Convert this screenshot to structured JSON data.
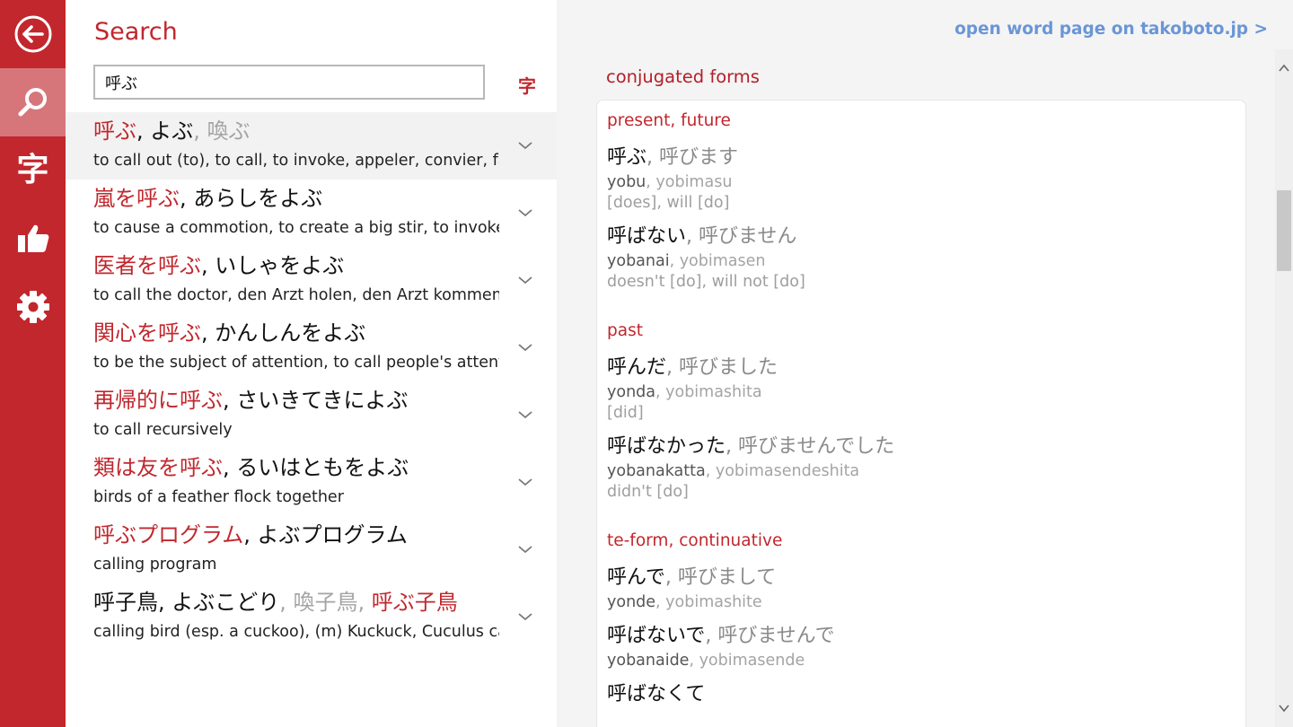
{
  "search": {
    "title": "Search",
    "query": "呼ぶ",
    "kanji_toggle": "字"
  },
  "rail": {
    "kanji_label": "字",
    "icons": [
      "back-icon",
      "search-icon",
      "kanji-icon",
      "thumbs-up-icon",
      "gear-icon"
    ]
  },
  "results": [
    {
      "head": [
        {
          "t": "呼ぶ",
          "c": "m"
        },
        {
          "t": ", ",
          "c": "s"
        },
        {
          "t": "よぶ",
          "c": "k"
        },
        {
          "t": ", 喚ぶ",
          "c": "g"
        }
      ],
      "gloss": "to call out (to), to call, to invoke, appeler, convier, faire venir"
    },
    {
      "head": [
        {
          "t": "嵐を呼ぶ",
          "c": "m"
        },
        {
          "t": ", ",
          "c": "s"
        },
        {
          "t": "あらしをよぶ",
          "c": "k"
        }
      ],
      "gloss": "to cause a commotion, to create a big stir, to invoke a storm"
    },
    {
      "head": [
        {
          "t": "医者を呼ぶ",
          "c": "m"
        },
        {
          "t": ", ",
          "c": "s"
        },
        {
          "t": "いしゃをよぶ",
          "c": "k"
        }
      ],
      "gloss": "to call the doctor, den Arzt holen, den Arzt kommen lassen"
    },
    {
      "head": [
        {
          "t": "関心を呼ぶ",
          "c": "m"
        },
        {
          "t": ", ",
          "c": "s"
        },
        {
          "t": "かんしんをよぶ",
          "c": "k"
        }
      ],
      "gloss": "to be the subject of attention, to call people's attention"
    },
    {
      "head": [
        {
          "t": "再帰的に呼ぶ",
          "c": "m"
        },
        {
          "t": ", ",
          "c": "s"
        },
        {
          "t": "さいきてきによぶ",
          "c": "k"
        }
      ],
      "gloss": "to call recursively"
    },
    {
      "head": [
        {
          "t": "類は友を呼ぶ",
          "c": "m"
        },
        {
          "t": ", ",
          "c": "s"
        },
        {
          "t": "るいはともをよぶ",
          "c": "k"
        }
      ],
      "gloss": "birds of a feather flock together"
    },
    {
      "head": [
        {
          "t": "呼ぶプログラム",
          "c": "m"
        },
        {
          "t": ", ",
          "c": "s"
        },
        {
          "t": "よぶプログラム",
          "c": "k"
        }
      ],
      "gloss": "calling program"
    },
    {
      "head": [
        {
          "t": "呼子鳥",
          "c": "k"
        },
        {
          "t": ", ",
          "c": "s"
        },
        {
          "t": "よぶこどり",
          "c": "k"
        },
        {
          "t": ", 喚子鳥, ",
          "c": "g"
        },
        {
          "t": "呼ぶ子鳥",
          "c": "m"
        }
      ],
      "gloss": "calling bird (esp. a cuckoo), (m) Kuckuck, Cuculus canorus"
    }
  ],
  "detail": {
    "open_link": "open word page on takoboto.jp >",
    "section_title": "conjugated forms",
    "groups": [
      {
        "category": "present, future",
        "entries": [
          {
            "plain": "呼ぶ",
            "polite": ", 呼びます",
            "romaji_plain": "yobu",
            "romaji_polite": ", yobimasu",
            "meaning": "[does], will [do]"
          },
          {
            "plain": "呼ばない",
            "polite": ", 呼びません",
            "romaji_plain": "yobanai",
            "romaji_polite": ", yobimasen",
            "meaning": "doesn't [do], will not [do]"
          }
        ]
      },
      {
        "category": "past",
        "entries": [
          {
            "plain": "呼んだ",
            "polite": ", 呼びました",
            "romaji_plain": "yonda",
            "romaji_polite": ", yobimashita",
            "meaning": "[did]"
          },
          {
            "plain": "呼ばなかった",
            "polite": ", 呼びませんでした",
            "romaji_plain": "yobanakatta",
            "romaji_polite": ", yobimasendeshita",
            "meaning": "didn't [do]"
          }
        ]
      },
      {
        "category": "te-form, continuative",
        "entries": [
          {
            "plain": "呼んで",
            "polite": ", 呼びまして",
            "romaji_plain": "yonde",
            "romaji_polite": ", yobimashite",
            "meaning": ""
          },
          {
            "plain": "呼ばないで",
            "polite": ", 呼びませんで",
            "romaji_plain": "yobanaide",
            "romaji_polite": ", yobimasende",
            "meaning": ""
          },
          {
            "plain": "呼ばなくて",
            "polite": "",
            "romaji_plain": "",
            "romaji_polite": "",
            "meaning": ""
          }
        ]
      }
    ]
  },
  "colors": {
    "accent": "#c1272d",
    "rail_active": "#d7767a",
    "link": "#6a96d6",
    "muted": "#a4a4a4"
  }
}
